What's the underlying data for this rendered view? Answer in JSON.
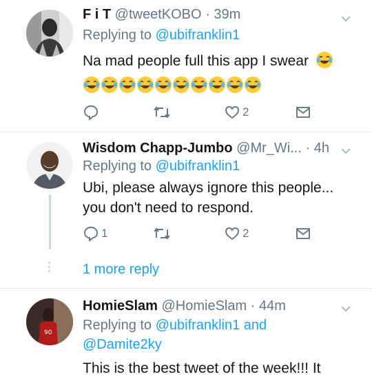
{
  "tweets": [
    {
      "name": "F i T",
      "handle": "@tweetKOBO",
      "time": "39m",
      "replying_prefix": "Replying to",
      "replying_mentions": "@ubifranklin1",
      "body_line1": "Na mad people full this app I swear",
      "emoji_name": "face-with-tears-of-joy",
      "emoji_count": 10,
      "reply_count": "",
      "retweet_count": "",
      "like_count": "2"
    },
    {
      "name": "Wisdom Chapp-Jumbo",
      "handle": "@Mr_Wi...",
      "time": "4h",
      "replying_prefix": "Replying to",
      "replying_mentions": "@ubifranklin1",
      "body_line1": "Ubi, please always ignore this people...",
      "body_line2": "you don't need to respond.",
      "reply_count": "1",
      "retweet_count": "",
      "like_count": "2"
    },
    {
      "name": "HomieSlam",
      "handle": "@HomieSlam",
      "time": "44m",
      "replying_prefix": "Replying to",
      "replying_mentions": "@ubifranklin1",
      "replying_and": "and",
      "replying_mentions2": "@Damite2ky",
      "body_line1": "This is the best tweet of the week!!! It"
    }
  ],
  "thread": {
    "more_replies": "1 more reply"
  },
  "separator": "·",
  "colors": {
    "link": "#1da1f2",
    "muted": "#657786",
    "text": "#14171a",
    "divider": "#e1e8ed"
  }
}
